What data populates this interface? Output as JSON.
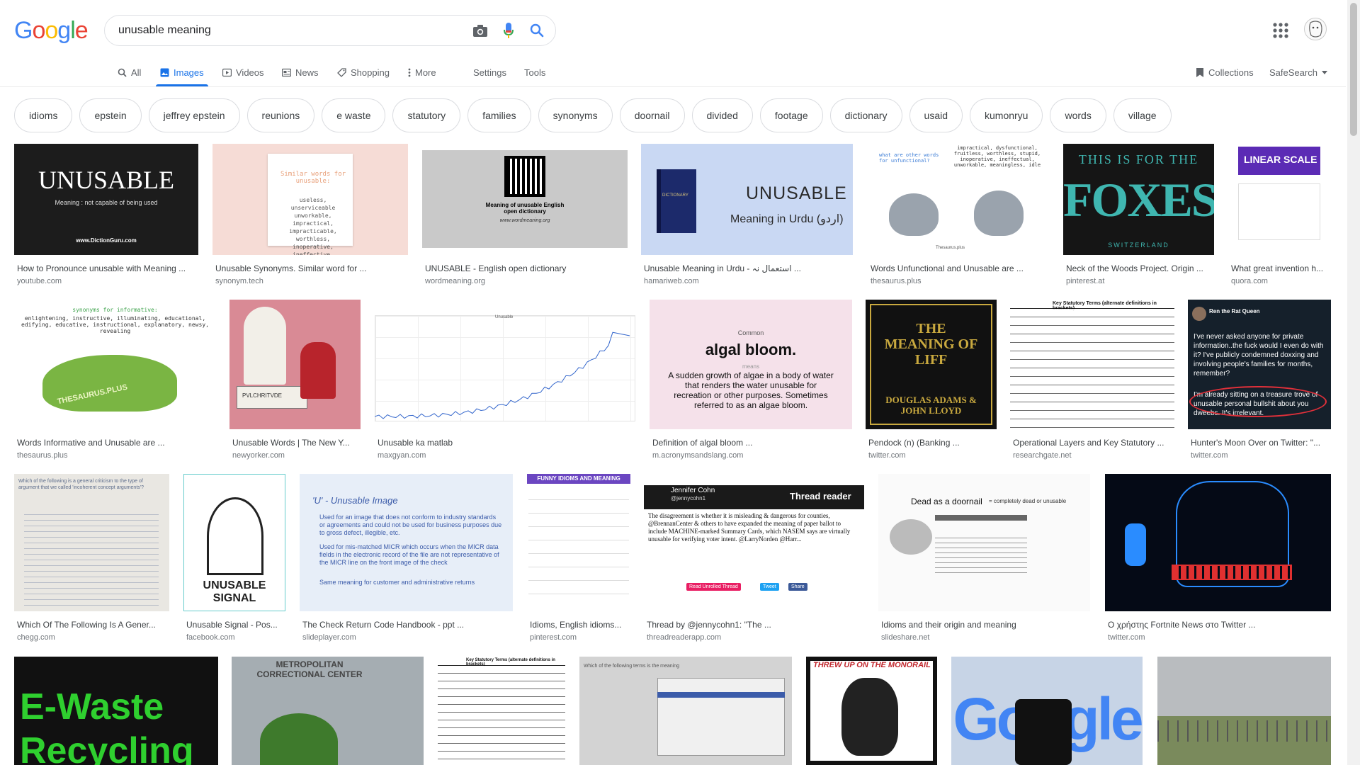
{
  "app": {
    "logo_letters": [
      "G",
      "o",
      "o",
      "g",
      "l",
      "e"
    ],
    "logo_colors": [
      "#4285f4",
      "#ea4335",
      "#fbbc05",
      "#4285f4",
      "#34a853",
      "#ea4335"
    ]
  },
  "search": {
    "query": "unusable meaning"
  },
  "tabs": [
    "All",
    "Images",
    "Videos",
    "News",
    "Shopping",
    "More",
    "Settings",
    "Tools"
  ],
  "right_tools": {
    "collections": "Collections",
    "safesearch": "SafeSearch"
  },
  "chips": [
    "idioms",
    "epstein",
    "jeffrey epstein",
    "reunions",
    "e waste",
    "statutory",
    "families",
    "synonyms",
    "doornail",
    "divided",
    "footage",
    "dictionary",
    "usaid",
    "kumonryu",
    "words",
    "village"
  ],
  "results": [
    {
      "title": "How to Pronounce unusable with Meaning ...",
      "source": "youtube.com",
      "thumb_text": "UNUSABLE",
      "thumb_sub": "Meaning : not capable of being used",
      "thumb_foot": "www.DictionGuru.com"
    },
    {
      "title": "Unusable Synonyms. Similar word for ...",
      "source": "synonym.tech",
      "thumb_text": "Similar words for unusable:",
      "thumb_sub": "useless, unserviceable unworkable, impractical, impracticable, worthless, inoperative, ineffective, inoperable, nonfunctional"
    },
    {
      "title": "UNUSABLE - English open dictionary",
      "source": "wordmeaning.org",
      "thumb_text": "Meaning of unusable English open dictionary",
      "thumb_sub": "www.wordmeaning.org"
    },
    {
      "title": "Unusable Meaning in Urdu - استعمال نہ ...",
      "source": "hamariweb.com",
      "thumb_text": "UNUSABLE",
      "thumb_sub": "Meaning in Urdu (اردو)",
      "thumb_foot": "DICTIONARY"
    },
    {
      "title": "Words Unfunctional and Unusable are ...",
      "source": "thesaurus.plus",
      "thumb_text": "what are other words for unfunctional?",
      "thumb_sub": "impractical, dysfunctional, fruitless, worthless, stupid, inoperative, ineffectual, unworkable, meaningless, idle",
      "thumb_foot": "Thesaurus.plus"
    },
    {
      "title": "Neck of the Woods Project. Origin ...",
      "source": "pinterest.at",
      "thumb_text": "FOXES",
      "thumb_sub": "THIS IS FOR THE",
      "thumb_foot": "SWITZERLAND"
    },
    {
      "title": "What great invention h...",
      "source": "quora.com",
      "thumb_text": "LINEAR SCALE"
    },
    {
      "title": "Words Informative and Unusable are ...",
      "source": "thesaurus.plus",
      "thumb_text": "synonyms for informative:",
      "thumb_sub": "enlightening, instructive, illuminating, educational, edifying, educative, instructional, explanatory, newsy, revealing",
      "thumb_foot": "THESAURUS.PLUS"
    },
    {
      "title": "Unusable Words | The New Y...",
      "source": "newyorker.com",
      "thumb_text": "PVLCHRITVDE"
    },
    {
      "title": "Unusable ka matlab",
      "source": "maxgyan.com",
      "thumb_text": "Unusable"
    },
    {
      "title": "Definition of algal bloom ...",
      "source": "m.acronymsandslang.com",
      "thumb_text": "algal bloom.",
      "thumb_sub": "A sudden growth of algae in a body of water that renders the water unusable for recreation or other purposes. Sometimes referred to as an algae bloom.",
      "thumb_foot": "Common",
      "thumb_extra": "means"
    },
    {
      "title": "Pendock (n) (Banking ...",
      "source": "twitter.com",
      "thumb_text": "THE MEANING OF LIFF",
      "thumb_sub": "DOUGLAS ADAMS & JOHN LLOYD"
    },
    {
      "title": "Operational Layers and Key Statutory ...",
      "source": "researchgate.net",
      "thumb_text": "Key Statutory Terms (alternate definitions in brackets)"
    },
    {
      "title": "Hunter's Moon Over on Twitter: \"...",
      "source": "twitter.com",
      "thumb_text": "Ren the Rat Queen",
      "thumb_sub": "I've never asked anyone for private information..the fuck would I even do with it? I've publicly condemned doxxing and involving people's families for months, remember?",
      "thumb_foot": "I'm already sitting on a treasure trove of unusable personal bullshit about you dweebs. It's irrelevant."
    },
    {
      "title": "Which Of The Following Is A Gener...",
      "source": "chegg.com",
      "thumb_text": "Which of the following is a general criticism to the type of argument that we called 'incoherent concept arguments'?"
    },
    {
      "title": "Unusable Signal - Pos...",
      "source": "facebook.com",
      "thumb_text": "UNUSABLE SIGNAL"
    },
    {
      "title": "The Check Return Code Handbook - ppt ...",
      "source": "slideplayer.com",
      "thumb_text": "'U' - Unusable Image",
      "thumb_sub": "Used for an image that does not conform to industry standards or agreements and could not be used for business purposes due to gross defect, illegible, etc.",
      "thumb_foot": "Used for mis-matched MICR which occurs when the MICR data fields in the electronic record of the file are not representative of the MICR line on the front image of the check",
      "thumb_extra": "Same meaning for customer and administrative returns"
    },
    {
      "title": "Idioms, English idioms...",
      "source": "pinterest.com",
      "thumb_text": "FUNNY IDIOMS AND MEANING"
    },
    {
      "title": "Thread by @jennycohn1: \"The ...",
      "source": "threadreaderapp.com",
      "thumb_text": "Thread reader",
      "thumb_sub": "The disagreement is whether it is misleading & dangerous for counties, @BrennanCenter & others to have expanded the meaning of paper ballot to include MACHINE-marked Summary Cards, which NASEM says are virtually unusable for verifying voter intent. @LarryNorden @Harr...",
      "thumb_foot": "Jennifer Cohn",
      "thumb_extra": "@jennycohn1",
      "btn1": "Read Unrolled Thread",
      "btn2": "Tweet",
      "btn3": "Share"
    },
    {
      "title": "Idioms and their origin and meaning",
      "source": "slideshare.net",
      "thumb_text": "Dead as a doornail",
      "thumb_sub": "= completely dead or unusable"
    },
    {
      "title": "Ο χρήστης Fortnite News στο Twitter ...",
      "source": "twitter.com",
      "thumb_text": ""
    },
    {
      "title": "",
      "source": "",
      "thumb_text": "E-Waste Recycling"
    },
    {
      "title": "",
      "source": "",
      "thumb_text": "METROPOLITAN CORRECTIONAL CENTER"
    },
    {
      "title": "",
      "source": "",
      "thumb_text": "Key Statutory Terms (alternate definitions in brackets)"
    },
    {
      "title": "",
      "source": "",
      "thumb_text": "Which of the following terms is the meaning"
    },
    {
      "title": "",
      "source": "",
      "thumb_text": "THREW UP ON THE MONORAIL"
    },
    {
      "title": "",
      "source": "",
      "thumb_text": "Google"
    },
    {
      "title": "",
      "source": "",
      "thumb_text": ""
    }
  ]
}
